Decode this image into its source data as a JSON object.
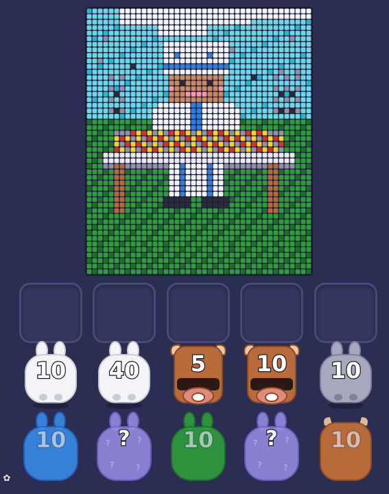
{
  "board": {
    "cols": 41,
    "rows": 48,
    "palette": {
      "sky": "#6fd6ea",
      "sky_dark": "#28b7cf",
      "cloud": "#f4f6fa",
      "gray": "#8f92a8",
      "dark": "#2a2b36",
      "grass": "#2f9e3a",
      "grass_dark": "#1f6e29",
      "white": "#f2f4f8",
      "blue": "#2f7fe0",
      "skin": "#c98a62",
      "pink": "#f29aaa",
      "wood": "#b86a38",
      "yellow": "#f5d329",
      "red": "#d8332a",
      "table": "#e8e8ee"
    }
  },
  "slots": [
    {
      "state": "empty"
    },
    {
      "state": "empty"
    },
    {
      "state": "empty"
    },
    {
      "state": "empty"
    },
    {
      "state": "empty"
    }
  ],
  "queue_front": [
    {
      "kind": "bunny",
      "color": "#f4f4f8",
      "shade": "#c9cbd8",
      "count": "10"
    },
    {
      "kind": "bunny",
      "color": "#f4f4f8",
      "shade": "#c9cbd8",
      "count": "40"
    },
    {
      "kind": "bull",
      "color": "#b86a38",
      "shade": "#8a4a22",
      "count": "5"
    },
    {
      "kind": "bull",
      "color": "#b86a38",
      "shade": "#8a4a22",
      "count": "10"
    },
    {
      "kind": "bunny",
      "color": "#a6a8c0",
      "shade": "#7f819c",
      "count": "10"
    }
  ],
  "queue_back": [
    {
      "kind": "bunny-back",
      "color": "#3a8ff0",
      "shade": "#2366c2",
      "count": "10",
      "style": "ghost"
    },
    {
      "kind": "bunny-back",
      "color": "#9a8fe8",
      "shade": "#6f64c4",
      "count": "?",
      "style": "mystery"
    },
    {
      "kind": "bunny-back",
      "color": "#2fa33a",
      "shade": "#1d7426",
      "count": "10",
      "style": "ghost"
    },
    {
      "kind": "bunny-back",
      "color": "#9a8fe8",
      "shade": "#6f64c4",
      "count": "?",
      "style": "mystery"
    },
    {
      "kind": "bull-back",
      "color": "#b86a38",
      "shade": "#8a4a22",
      "count": "10",
      "style": "ghost"
    }
  ],
  "icons": {
    "settings": "gear-icon"
  }
}
